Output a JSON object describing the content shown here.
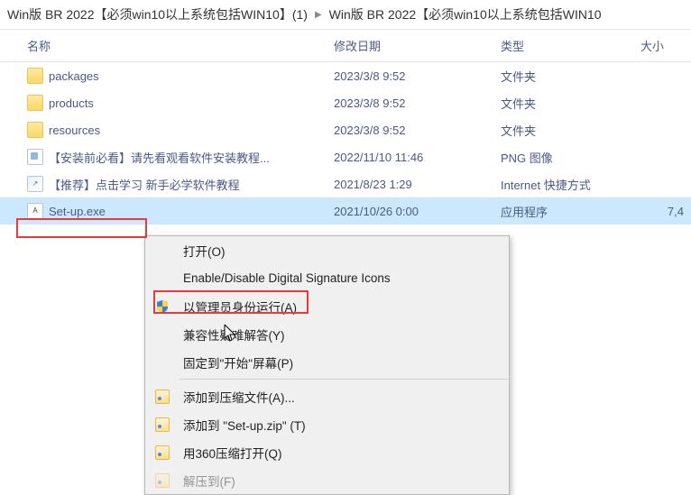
{
  "breadcrumb": {
    "item1": "Win版 BR 2022【必须win10以上系统包括WIN10】(1)",
    "item2": "Win版 BR 2022【必须win10以上系统包括WIN10"
  },
  "columns": {
    "name": "名称",
    "date": "修改日期",
    "type": "类型",
    "size": "大小"
  },
  "files": [
    {
      "name": "packages",
      "date": "2023/3/8 9:52",
      "type": "文件夹",
      "size": "",
      "kind": "folder"
    },
    {
      "name": "products",
      "date": "2023/3/8 9:52",
      "type": "文件夹",
      "size": "",
      "kind": "folder"
    },
    {
      "name": "resources",
      "date": "2023/3/8 9:52",
      "type": "文件夹",
      "size": "",
      "kind": "folder"
    },
    {
      "name": "【安装前必看】请先看观看软件安装教程...",
      "date": "2022/11/10 11:46",
      "type": "PNG 图像",
      "size": "",
      "kind": "png"
    },
    {
      "name": "【推荐】点击学习 新手必学软件教程",
      "date": "2021/8/23 1:29",
      "type": "Internet 快捷方式",
      "size": "",
      "kind": "link"
    },
    {
      "name": "Set-up.exe",
      "date": "2021/10/26 0:00",
      "type": "应用程序",
      "size": "7,4",
      "kind": "exe"
    }
  ],
  "context_menu": {
    "open": "打开(O)",
    "sig": "Enable/Disable Digital Signature Icons",
    "runadmin": "以管理员身份运行(A)",
    "compat": "兼容性疑难解答(Y)",
    "pin": "固定到\"开始\"屏幕(P)",
    "addzip": "添加到压缩文件(A)...",
    "addsetupzip": "添加到 \"Set-up.zip\" (T)",
    "open360": "用360压缩打开(Q)",
    "extract": "解压到(F)"
  }
}
